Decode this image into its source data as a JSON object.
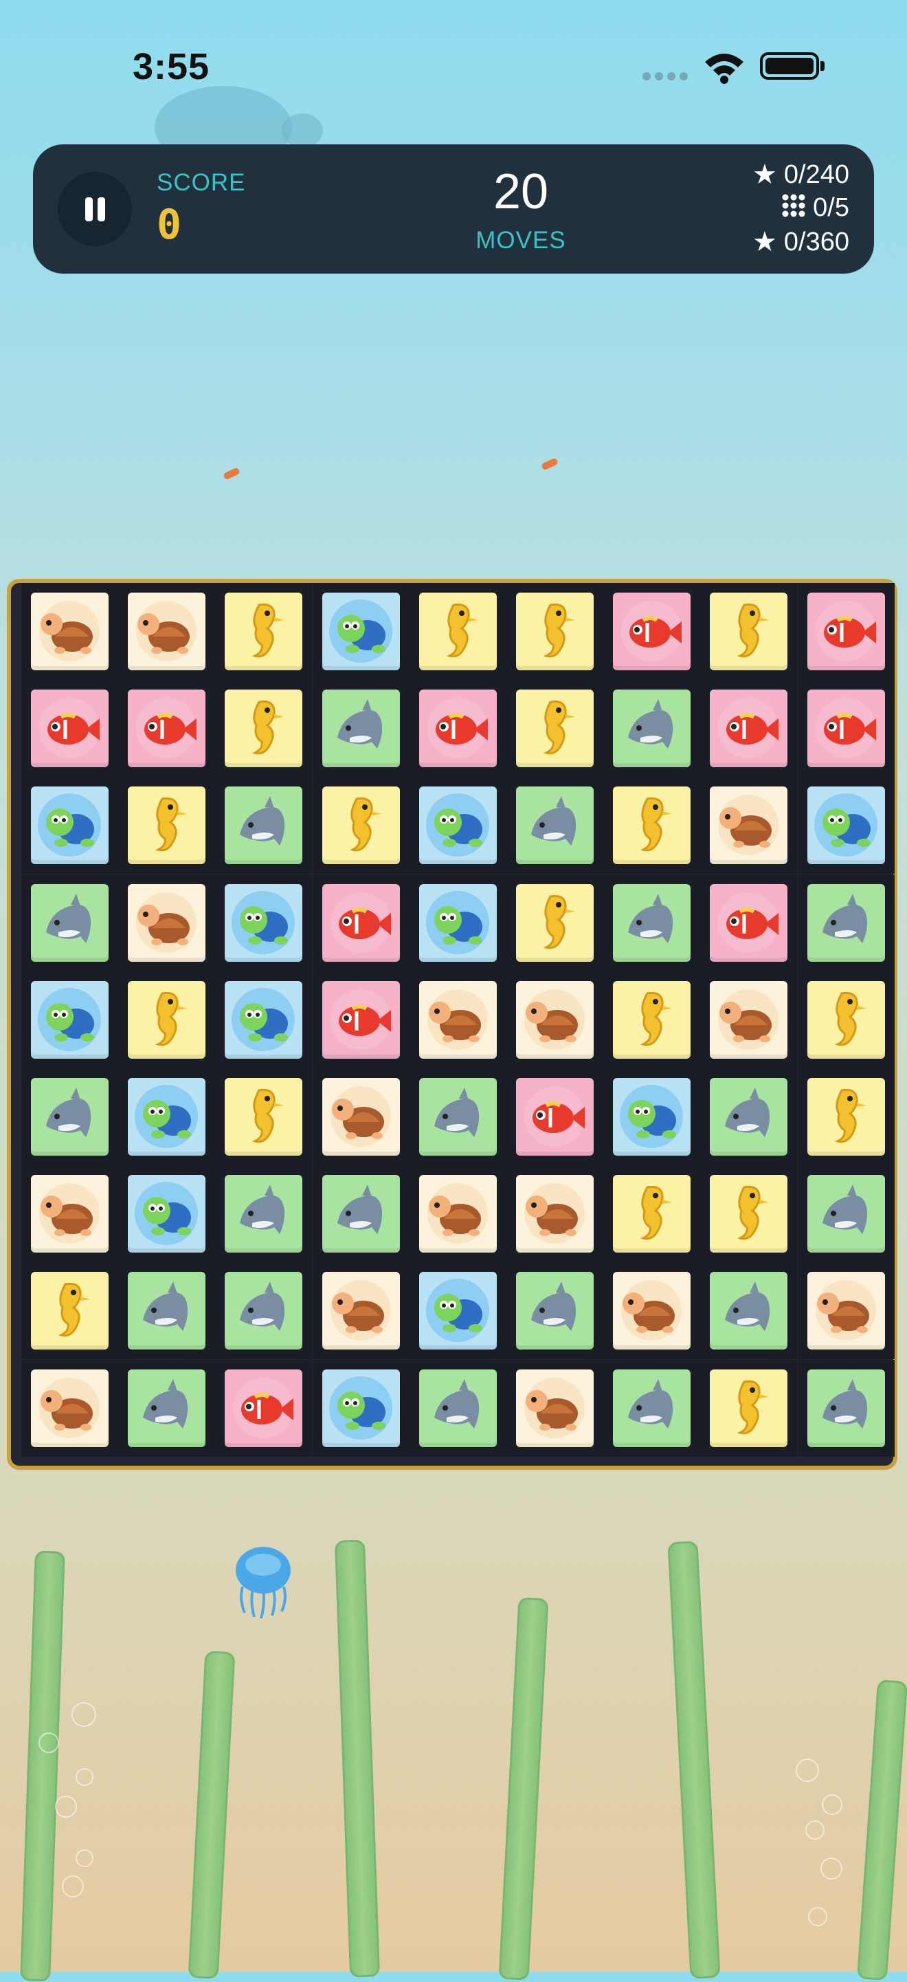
{
  "status": {
    "time": "3:55"
  },
  "hud": {
    "score_label": "SCORE",
    "score": "0",
    "moves": "20",
    "moves_label": "MOVES",
    "goals": [
      {
        "icon": "star-icon",
        "text": "0/240"
      },
      {
        "icon": "grid-icon",
        "text": "0/5"
      },
      {
        "icon": "star-icon",
        "text": "0/360"
      }
    ]
  },
  "colors": {
    "turtle_bg": "#fdf3dc",
    "seahorse_bg": "#fbf2a6",
    "fish_bg": "#f6b3c8",
    "dolphin_bg": "#a9e3a0",
    "blueturtle_bg": "#b9e2f5",
    "frame": "#c9a03e",
    "hud_bg": "#20303d",
    "accent": "#3cc2c4",
    "score": "#f0c23a"
  },
  "board": {
    "rows": [
      [
        "turtle",
        "turtle",
        "seahorse",
        "blueturtle",
        "seahorse",
        "seahorse",
        "fish",
        "seahorse",
        "fish"
      ],
      [
        "fish",
        "fish",
        "seahorse",
        "dolphin",
        "fish",
        "seahorse",
        "dolphin",
        "fish",
        "fish"
      ],
      [
        "blueturtle",
        "seahorse",
        "dolphin",
        "seahorse",
        "blueturtle",
        "dolphin",
        "seahorse",
        "turtle",
        "blueturtle"
      ],
      [
        "dolphin",
        "turtle",
        "blueturtle",
        "fish",
        "blueturtle",
        "seahorse",
        "dolphin",
        "fish",
        "dolphin"
      ],
      [
        "blueturtle",
        "seahorse",
        "blueturtle",
        "fish",
        "turtle",
        "turtle",
        "seahorse",
        "turtle",
        "seahorse"
      ],
      [
        "dolphin",
        "blueturtle",
        "seahorse",
        "turtle",
        "dolphin",
        "fish",
        "blueturtle",
        "dolphin",
        "seahorse"
      ],
      [
        "turtle",
        "blueturtle",
        "dolphin",
        "dolphin",
        "turtle",
        "turtle",
        "seahorse",
        "seahorse",
        "dolphin"
      ],
      [
        "seahorse",
        "dolphin",
        "dolphin",
        "turtle",
        "blueturtle",
        "dolphin",
        "turtle",
        "dolphin",
        "turtle"
      ],
      [
        "turtle",
        "dolphin",
        "fish",
        "blueturtle",
        "dolphin",
        "turtle",
        "dolphin",
        "seahorse",
        "dolphin"
      ]
    ]
  }
}
